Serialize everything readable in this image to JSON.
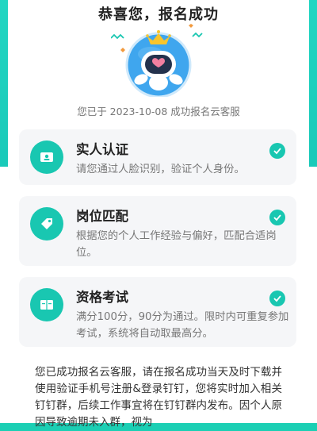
{
  "colors": {
    "accent": "#19c7b1",
    "background_teal": "#1bcfb4"
  },
  "header": {
    "title": "恭喜您，报名成功"
  },
  "hero": {
    "image": "robot-mascot-with-crown-and-heart"
  },
  "registration": {
    "message": "您已于 2023-10-08 成功报名云客服"
  },
  "steps": [
    {
      "icon": "id-card-icon",
      "title": "实人认证",
      "description": "请您通过人脸识别，验证个人身份。",
      "status": "completed"
    },
    {
      "icon": "tag-icon",
      "title": "岗位匹配",
      "description": "根据您的个人工作经验与偏好，匹配合适岗位。",
      "status": "completed"
    },
    {
      "icon": "book-icon",
      "title": "资格考试",
      "description": "满分100分，90分为通过。限时内可重复参加考试，系统将自动取最高分。",
      "status": "completed"
    }
  ],
  "notice": {
    "text": "您已成功报名云客服，请在报名成功当天及时下载并使用验证手机号注册&登录钉钉，您将实时加入相关钉钉群，后续工作事宜将在钉钉群内发布。因个人原因导致逾期未入群，视为"
  }
}
